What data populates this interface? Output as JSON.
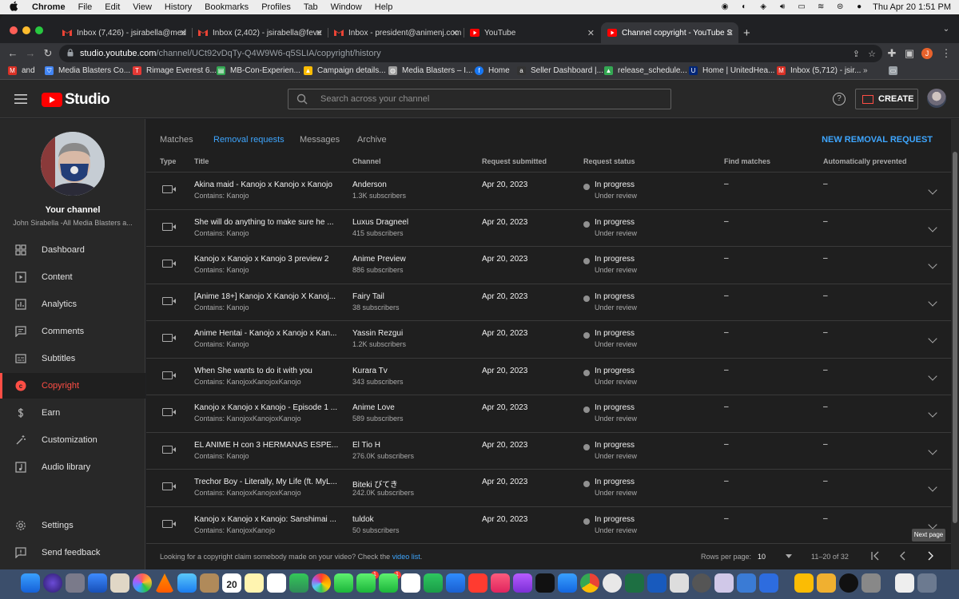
{
  "menubar": {
    "app": "Chrome",
    "items": [
      "File",
      "Edit",
      "View",
      "History",
      "Bookmarks",
      "Profiles",
      "Tab",
      "Window",
      "Help"
    ],
    "clock": "Thu Apr 20  1:51 PM"
  },
  "browser": {
    "tabs": [
      {
        "title": "Inbox (7,426) - jsirabella@med",
        "favicon": "gmail-icon"
      },
      {
        "title": "Inbox (2,402) - jsirabella@feve",
        "favicon": "gmail-icon"
      },
      {
        "title": "Inbox - president@animenj.com",
        "favicon": "gmail-icon"
      },
      {
        "title": "YouTube",
        "favicon": "youtube-icon"
      },
      {
        "title": "Channel copyright - YouTube S",
        "favicon": "youtube-icon"
      }
    ],
    "url_domain": "studio.youtube.com",
    "url_path": "/channel/UCt92vDqTy-Q4W9W6-q5SLIA/copyright/history",
    "profile_initial": "J",
    "bookmarks": [
      {
        "label": "and",
        "color": "#d93025"
      },
      {
        "label": "Media Blasters Co...",
        "color": "#4285f4"
      },
      {
        "label": "Rimage Everest 6...",
        "color": "#e53935"
      },
      {
        "label": "MB-Con-Experien...",
        "color": "#34a853"
      },
      {
        "label": "Campaign details...",
        "color": "#fbbc04"
      },
      {
        "label": "Media Blasters – I...",
        "color": "#9e9e9e"
      },
      {
        "label": "Home",
        "color": "#1877f2"
      },
      {
        "label": "Seller Dashboard |...",
        "color": "#333333"
      },
      {
        "label": "release_schedule...",
        "color": "#34a853"
      },
      {
        "label": "Home | UnitedHea...",
        "color": "#002677"
      },
      {
        "label": "Inbox (5,712) - jsir...",
        "color": "#d93025"
      }
    ]
  },
  "header": {
    "logo_text": "Studio",
    "search_placeholder": "Search across your channel",
    "create_label": "CREATE",
    "help_glyph": "?"
  },
  "sidebar": {
    "channel_title": "Your channel",
    "channel_name": "John Sirabella -All Media Blasters a...",
    "items": [
      {
        "label": "Dashboard",
        "icon": "dashboard-icon"
      },
      {
        "label": "Content",
        "icon": "content-icon"
      },
      {
        "label": "Analytics",
        "icon": "analytics-icon"
      },
      {
        "label": "Comments",
        "icon": "comments-icon"
      },
      {
        "label": "Subtitles",
        "icon": "subtitles-icon"
      },
      {
        "label": "Copyright",
        "icon": "copyright-icon",
        "active": true
      },
      {
        "label": "Earn",
        "icon": "dollar-icon"
      },
      {
        "label": "Customization",
        "icon": "magic-wand-icon"
      },
      {
        "label": "Audio library",
        "icon": "audio-library-icon"
      }
    ],
    "bottom_items": [
      {
        "label": "Settings",
        "icon": "gear-icon"
      },
      {
        "label": "Send feedback",
        "icon": "feedback-icon"
      }
    ]
  },
  "main": {
    "tabs": [
      "Matches",
      "Removal requests",
      "Messages",
      "Archive"
    ],
    "active_tab": "Removal requests",
    "new_removal_label": "NEW REMOVAL REQUEST",
    "columns": [
      "Type",
      "Title",
      "Channel",
      "Request submitted",
      "Request status",
      "Find matches",
      "Automatically prevented"
    ],
    "rows": [
      {
        "title": "Akina maid - Kanojo x Kanojo x Kanojo",
        "contains": "Contains: Kanojo",
        "channel": "Anderson",
        "subs": "1.3K subscribers",
        "date": "Apr 20, 2023",
        "status": "In progress",
        "status_sub": "Under review",
        "find": "–",
        "auto": "–"
      },
      {
        "title": "She will do anything to make sure he ...",
        "contains": "Contains: Kanojo",
        "channel": "Luxus Dragneel",
        "subs": "415 subscribers",
        "date": "Apr 20, 2023",
        "status": "In progress",
        "status_sub": "Under review",
        "find": "–",
        "auto": "–"
      },
      {
        "title": "Kanojo x Kanojo x Kanojo 3 preview 2",
        "contains": "Contains: Kanojo",
        "channel": "Anime Preview",
        "subs": "886 subscribers",
        "date": "Apr 20, 2023",
        "status": "In progress",
        "status_sub": "Under review",
        "find": "–",
        "auto": "–"
      },
      {
        "title": "[Anime 18+] Kanojo X Kanojo X Kanoj...",
        "contains": "Contains: Kanojo",
        "channel": "Fairy Tail",
        "subs": "38 subscribers",
        "date": "Apr 20, 2023",
        "status": "In progress",
        "status_sub": "Under review",
        "find": "–",
        "auto": "–"
      },
      {
        "title": "Anime Hentai - Kanojo x Kanojo x Kan...",
        "contains": "Contains: Kanojo",
        "channel": "Yassin Rezgui",
        "subs": "1.2K subscribers",
        "date": "Apr 20, 2023",
        "status": "In progress",
        "status_sub": "Under review",
        "find": "–",
        "auto": "–"
      },
      {
        "title": "When She wants to do it with you",
        "contains": "Contains: KanojoxKanojoxKanojo",
        "channel": "Kurara Tv",
        "subs": "343 subscribers",
        "date": "Apr 20, 2023",
        "status": "In progress",
        "status_sub": "Under review",
        "find": "–",
        "auto": "–"
      },
      {
        "title": "Kanojo x Kanojo x Kanojo - Episode 1 ...",
        "contains": "Contains: KanojoxKanojoxKanojo",
        "channel": "Anime Love",
        "subs": "589 subscribers",
        "date": "Apr 20, 2023",
        "status": "In progress",
        "status_sub": "Under review",
        "find": "–",
        "auto": "–"
      },
      {
        "title": "EL ANIME H con 3 HERMANAS ESPE...",
        "contains": "Contains: Kanojo",
        "channel": "El Tio H",
        "subs": "276.0K subscribers",
        "date": "Apr 20, 2023",
        "status": "In progress",
        "status_sub": "Under review",
        "find": "–",
        "auto": "–"
      },
      {
        "title": "Trechor Boy - Literally, My Life (ft. MyL...",
        "contains": "Contains: KanojoxKanojoxKanojo",
        "channel": "Biteki びてき",
        "subs": "242.0K subscribers",
        "date": "Apr 20, 2023",
        "status": "In progress",
        "status_sub": "Under review",
        "find": "–",
        "auto": "–"
      },
      {
        "title": "Kanojo x Kanojo x Kanojo: Sanshimai ...",
        "contains": "Contains: KanojoxKanojo",
        "channel": "tuldok",
        "subs": "50 subscribers",
        "date": "Apr 20, 2023",
        "status": "In progress",
        "status_sub": "Under review",
        "find": "–",
        "auto": "–"
      }
    ],
    "footer": {
      "note": "Looking for a copyright claim somebody made on your video? Check the",
      "link": "video list",
      "note_end": ".",
      "rows_per_page_label": "Rows per page:",
      "rows_per_page_value": "10",
      "range": "11–20 of 32",
      "tooltip": "Next page"
    }
  },
  "dock": {
    "calendar_day": "20",
    "badges": [
      "1",
      "1"
    ]
  }
}
